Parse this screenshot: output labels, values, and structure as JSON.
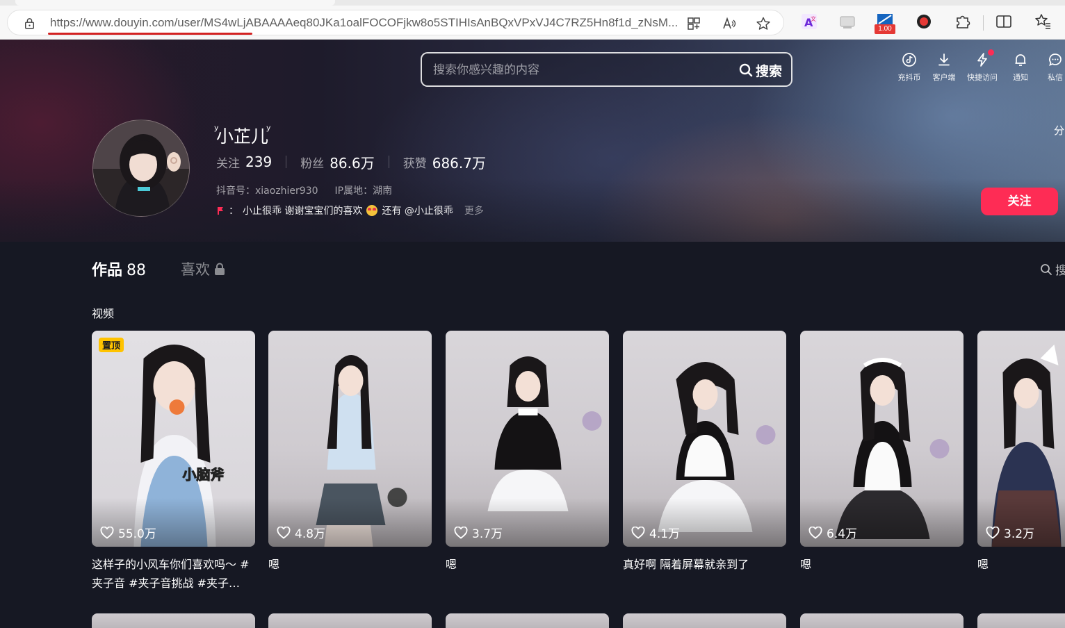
{
  "browser": {
    "url": "https://www.douyin.com/user/MS4wLjABAAAAeq80JKa1oalFOCOFjkw8o5STIHIsAnBQxVPxVJ4C7RZ5Hn8f1d_zNsM...",
    "speed_badge": "1.00",
    "icons": [
      "lock-icon",
      "app-grid-icon",
      "read-aloud-icon",
      "favorite-star-icon",
      "translate-icon",
      "extension-icon",
      "speed-icon",
      "record-icon",
      "puzzle-icon",
      "split-view-icon",
      "favorites-icon"
    ]
  },
  "header": {
    "search_placeholder": "搜索你感兴趣的内容",
    "search_button": "搜索",
    "nav": [
      {
        "label": "充抖币",
        "icon": "coin-icon"
      },
      {
        "label": "客户端",
        "icon": "download-icon"
      },
      {
        "label": "快捷访问",
        "icon": "lightning-icon"
      },
      {
        "label": "通知",
        "icon": "bell-icon"
      },
      {
        "label": "私信",
        "icon": "message-icon"
      }
    ],
    "share_partial": "分"
  },
  "profile": {
    "nickname": "ꙷ小芷儿ꙷ",
    "following_label": "关注",
    "following_value": "239",
    "followers_label": "粉丝",
    "followers_value": "86.6万",
    "likes_label": "获赞",
    "likes_value": "686.7万",
    "douyin_id": "抖音号：xiaozhier930",
    "ip_location": "IP属地：湖南",
    "bio_prefix": "：",
    "bio_text_1": "小止很乖 谢谢宝宝们的喜欢",
    "bio_text_2": "还有 @小止很乖",
    "bio_more": "更多",
    "follow_button": "关注"
  },
  "tabs": {
    "works_label": "作品",
    "works_count": "88",
    "likes_label": "喜欢",
    "search_partial": "搜"
  },
  "section": {
    "title": "视频"
  },
  "videos": [
    {
      "likes": "55.0万",
      "caption": "这样子的小风车你们喜欢吗～ #夹子音 #夹子音挑战 #夹子…",
      "pinned": "置顶",
      "overlay_text": "小脑斧"
    },
    {
      "likes": "4.8万",
      "caption": "嗯"
    },
    {
      "likes": "3.7万",
      "caption": "嗯"
    },
    {
      "likes": "4.1万",
      "caption": "真好啊 隔着屏幕就亲到了"
    },
    {
      "likes": "6.4万",
      "caption": "嗯"
    },
    {
      "likes": "3.2万",
      "caption": "嗯"
    }
  ],
  "colors": {
    "accent": "#fe2c55",
    "background": "#161823",
    "pin": "#ffc300"
  }
}
